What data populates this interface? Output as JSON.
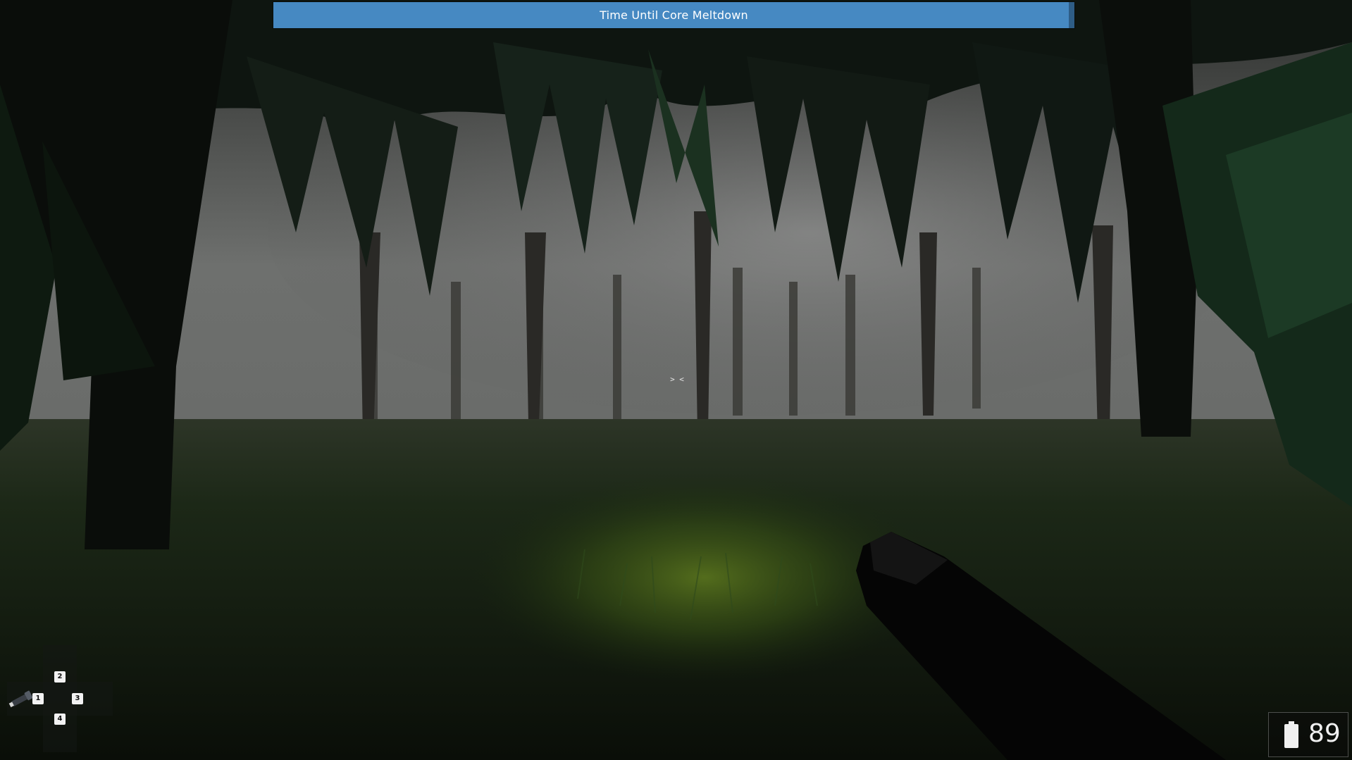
{
  "hud": {
    "timer": {
      "label": "Time Until Core Meltdown",
      "remaining_fraction": 0.993,
      "fill_color": "#4689c2",
      "track_color": "#2e5d86"
    },
    "crosshair": "> <",
    "inventory": {
      "slots": [
        {
          "key": "1",
          "item_icon": "flashlight-icon"
        },
        {
          "key": "2"
        },
        {
          "key": "3"
        },
        {
          "key": "4"
        }
      ]
    },
    "battery": {
      "icon": "battery-icon",
      "value": "89"
    }
  },
  "scene": {
    "description_colors": {
      "sky_fog": "#8c8c8c",
      "foliage_dark": "#0f1a12",
      "grass": "#233a18"
    }
  }
}
